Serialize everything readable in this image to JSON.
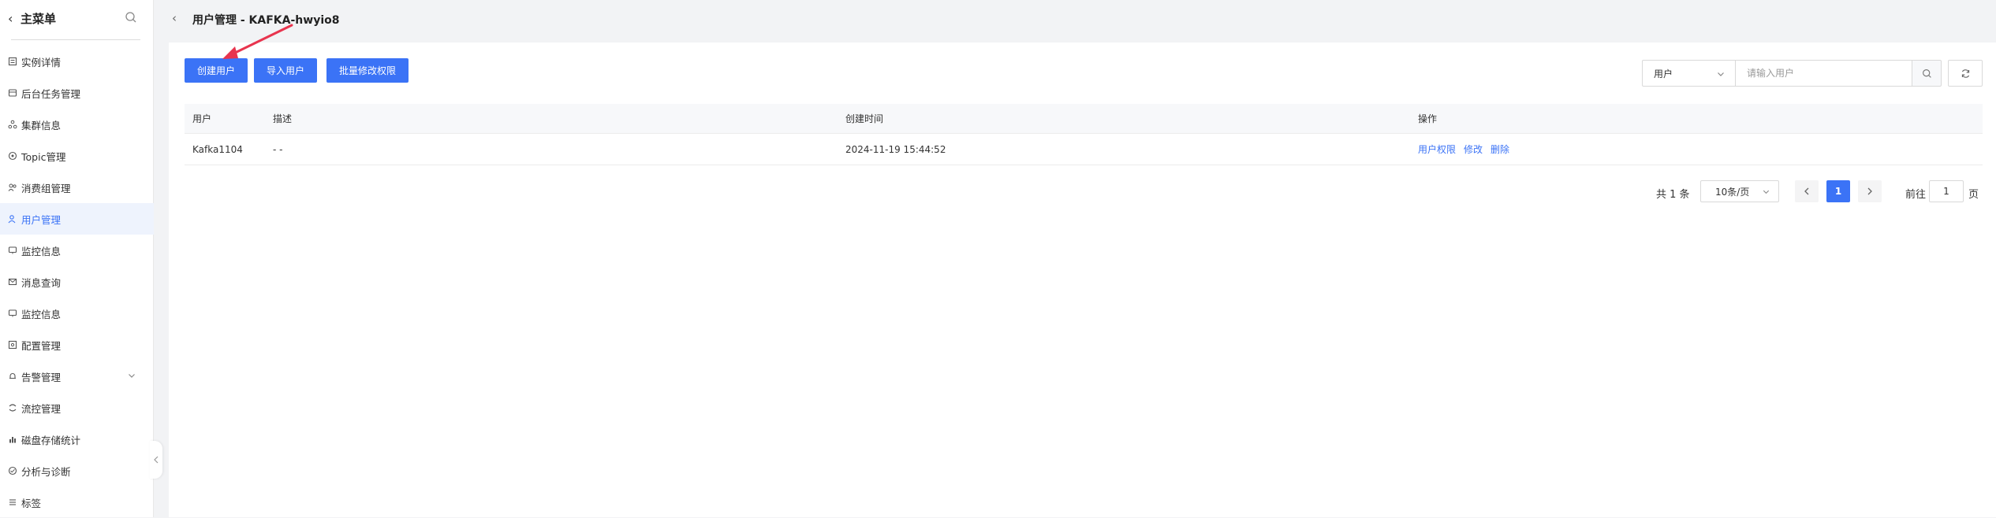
{
  "sidebar": {
    "title": "主菜单",
    "items": [
      {
        "label": "实例详情",
        "icon": "instance-icon"
      },
      {
        "label": "后台任务管理",
        "icon": "task-icon"
      },
      {
        "label": "集群信息",
        "icon": "cluster-icon"
      },
      {
        "label": "Topic管理",
        "icon": "topic-icon"
      },
      {
        "label": "消费组管理",
        "icon": "consumer-group-icon"
      },
      {
        "label": "用户管理",
        "icon": "user-icon",
        "active": true
      },
      {
        "label": "监控信息",
        "icon": "monitor-icon"
      },
      {
        "label": "消息查询",
        "icon": "message-icon"
      },
      {
        "label": "监控信息",
        "icon": "monitor-icon"
      },
      {
        "label": "配置管理",
        "icon": "config-icon"
      },
      {
        "label": "告警管理",
        "icon": "alarm-icon",
        "expandable": true
      },
      {
        "label": "流控管理",
        "icon": "flow-control-icon"
      },
      {
        "label": "磁盘存储统计",
        "icon": "disk-icon"
      },
      {
        "label": "分析与诊断",
        "icon": "diagnose-icon"
      },
      {
        "label": "标签",
        "icon": "tag-icon"
      }
    ]
  },
  "header": {
    "title": "用户管理 - KAFKA-hwyio8"
  },
  "toolbar": {
    "create_label": "创建用户",
    "import_label": "导入用户",
    "batch_label": "批量修改权限"
  },
  "filter": {
    "type_selected": "用户",
    "placeholder": "请输入用户"
  },
  "table": {
    "columns": [
      "用户",
      "描述",
      "创建时间",
      "操作"
    ],
    "rows": [
      {
        "user": "Kafka1104",
        "description": "- -",
        "created": "2024-11-19 15:44:52",
        "actions": [
          "用户权限",
          "修改",
          "删除"
        ]
      }
    ]
  },
  "pagination": {
    "total": "共 1 条",
    "page_size": "10条/页",
    "current_page": "1",
    "goto_label": "前往",
    "goto_value": "1",
    "page_suffix": "页"
  },
  "colors": {
    "primary": "#3b73f6",
    "annotation_arrow": "#e8344e"
  }
}
